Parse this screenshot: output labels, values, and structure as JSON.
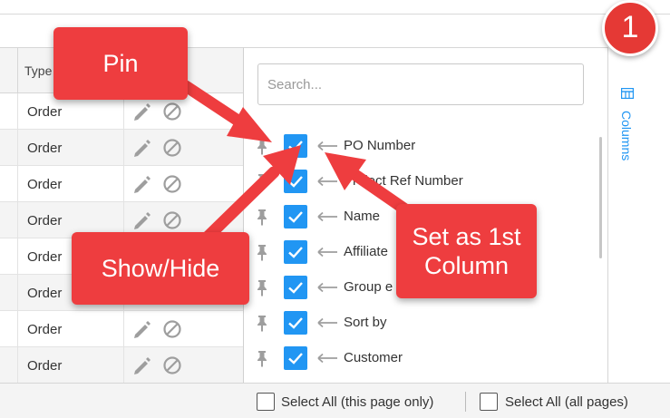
{
  "grid": {
    "header_type": "Type",
    "rows": [
      {
        "type": "Order"
      },
      {
        "type": "Order"
      },
      {
        "type": "Order"
      },
      {
        "type": "Order"
      },
      {
        "type": "Order"
      },
      {
        "type": "Order"
      },
      {
        "type": "Order"
      },
      {
        "type": "Order"
      }
    ]
  },
  "column_panel": {
    "search_placeholder": "Search...",
    "columns": [
      {
        "label": "PO Number",
        "checked": true
      },
      {
        "label": "Project Ref Number",
        "checked": true
      },
      {
        "label": "Name",
        "checked": true
      },
      {
        "label": "Affiliate",
        "checked": true
      },
      {
        "label": "Group e",
        "checked": true
      },
      {
        "label": "Sort by",
        "checked": true
      },
      {
        "label": "Customer",
        "checked": true
      }
    ]
  },
  "sidebar": {
    "columns_label": "Columns"
  },
  "bottom_bar": {
    "select_page_label": "Select All (this page only)",
    "select_all_label": "Select All (all pages)"
  },
  "annotations": {
    "badge": "1",
    "pin": "Pin",
    "show_hide": "Show/Hide",
    "set_first_line1": "Set as 1st",
    "set_first_line2": "Column"
  },
  "colors": {
    "accent": "#2196f3",
    "callout": "#ee3d3f",
    "badge": "#e53935"
  }
}
